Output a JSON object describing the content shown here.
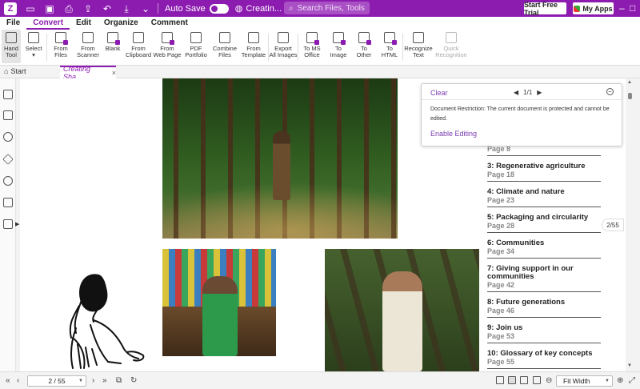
{
  "titlebar": {
    "autosave_label": "Auto Save",
    "doc_status": "Creatin... (SECURED)",
    "search_placeholder": "Search Files, Tools",
    "trial_button": "Start Free Trial",
    "apps_button": "My Apps"
  },
  "menu": {
    "items": [
      "File",
      "Convert",
      "Edit",
      "Organize",
      "Comment"
    ],
    "active": "Convert"
  },
  "ribbon": {
    "hand_tool": "Hand\nTool",
    "select": "Select",
    "from_files": "From\nFiles",
    "from_scanner": "From\nScanner",
    "blank": "Blank",
    "from_clipboard": "From\nClipboard",
    "from_web_page": "From\nWeb Page",
    "pdf_portfolio": "PDF\nPortfolio",
    "combine_files": "Combine\nFiles",
    "from_template": "From\nTemplate",
    "export_all_images": "Export\nAll Images",
    "to_ms_office": "To MS\nOffice",
    "to_image": "To\nImage",
    "to_other": "To\nOther",
    "to_html": "To\nHTML",
    "recognize_text": "Recognize\nText",
    "quick_recognition": "Quick\nRecognition"
  },
  "tabs": {
    "start": "Start",
    "document": "Creating Sha..."
  },
  "toc": [
    {
      "title": "",
      "page": "Page 8"
    },
    {
      "title": "3: Regenerative agriculture",
      "page": "Page 18"
    },
    {
      "title": "4: Climate and nature",
      "page": "Page 23"
    },
    {
      "title": "5: Packaging and circularity",
      "page": "Page 28"
    },
    {
      "title": "6: Communities",
      "page": "Page 34"
    },
    {
      "title": "7: Giving support in our communities",
      "page": "Page 42"
    },
    {
      "title": "8: Future generations",
      "page": "Page 46"
    },
    {
      "title": "9: Join us",
      "page": "Page 53"
    },
    {
      "title": "10: Glossary of key concepts",
      "page": "Page 55"
    }
  ],
  "popup": {
    "clear_label": "Clear",
    "counter": "1/1",
    "message": "Document Restriction: The current document is protected and cannot be edited.",
    "enable_editing": "Enable Editing"
  },
  "page_indicator": "2/55",
  "statusbar": {
    "page_field": "2 / 55",
    "zoom_field": "Fit Width"
  },
  "colors": {
    "accent": "#8c1bb0",
    "link": "#7a3bb0"
  }
}
